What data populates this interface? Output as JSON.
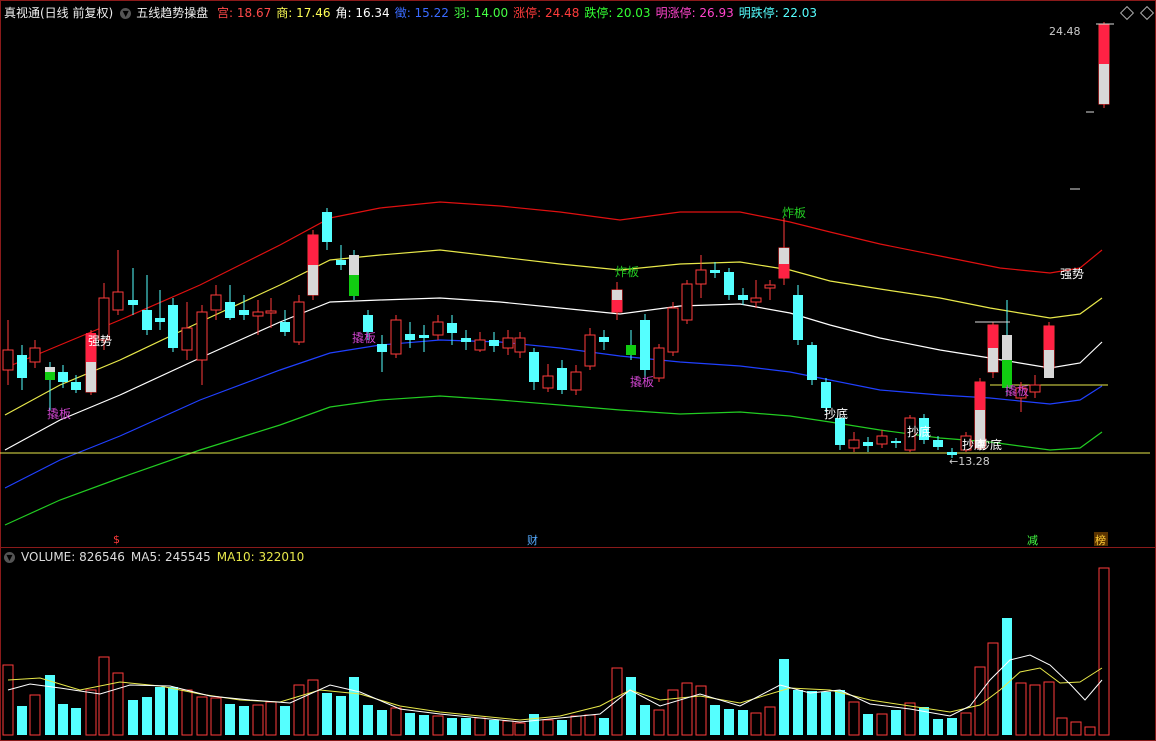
{
  "header": {
    "app_title": "真视通(日线 前复权)",
    "indicator_name": "五线趋势操盘",
    "items": [
      {
        "label": "宫: ",
        "value": "18.67",
        "color": "#ff4a4a"
      },
      {
        "label": "商: ",
        "value": "17.46",
        "color": "#ffff55"
      },
      {
        "label": "角: ",
        "value": "16.34",
        "color": "#ffffff"
      },
      {
        "label": "徵: ",
        "value": "15.22",
        "color": "#3a6bff"
      },
      {
        "label": "羽: ",
        "value": "14.00",
        "color": "#44ff44"
      },
      {
        "label": "涨停: ",
        "value": "24.48",
        "color": "#ff3b3b"
      },
      {
        "label": "跌停: ",
        "value": "20.03",
        "color": "#33ff33"
      },
      {
        "label": "明涨停: ",
        "value": "26.93",
        "color": "#ff44cc"
      },
      {
        "label": "明跌停: ",
        "value": "22.03",
        "color": "#55ffff"
      }
    ]
  },
  "price_labels": {
    "high": "24.48",
    "low": "←13.28"
  },
  "signals": {
    "strong": "强势",
    "board": "撬板",
    "blast": "炸板",
    "bottom": "抄底"
  },
  "markers": {
    "dollar": "$",
    "finance": "财",
    "reduce": "减",
    "rank": "榜"
  },
  "volume_header": {
    "volume_label": "VOLUME: ",
    "volume_value": "826546",
    "ma5_label": "MA5: ",
    "ma5_value": "245545",
    "ma10_label": "MA10: ",
    "ma10_value": "322010"
  },
  "colors": {
    "up": "#ff3b3b",
    "down": "#55ffff",
    "ma_red": "#e01010",
    "ma_yellow": "#e8e84a",
    "ma_white": "#ffffff",
    "ma_blue": "#2040ff",
    "ma_green": "#22cc22"
  }
}
